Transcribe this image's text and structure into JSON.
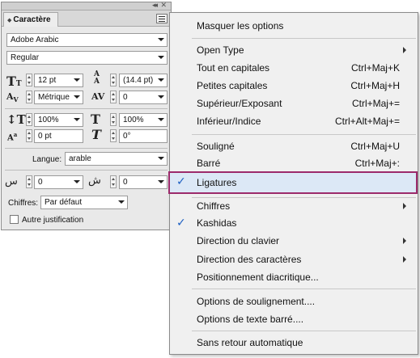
{
  "panel": {
    "tab_label": "Caractère",
    "font_family": "Adobe Arabic",
    "font_style": "Regular",
    "font_size": "12 pt",
    "leading": "(14.4 pt)",
    "kerning": "Métrique",
    "tracking": "0",
    "vertical_scale": "100%",
    "horizontal_scale": "100%",
    "baseline_shift": "0 pt",
    "skew": "0°",
    "language_label": "Langue:",
    "language_value": "arable",
    "insert_spacing_1": "0",
    "insert_spacing_2": "0",
    "digits_label": "Chiffres:",
    "digits_value": "Par défaut",
    "auto_justify_label": "Autre justification",
    "auto_justify_checked": false
  },
  "menu": {
    "items": [
      {
        "label": "Masquer les options",
        "shortcut": "",
        "submenu": false,
        "checked": false
      },
      {
        "label": "Open Type",
        "shortcut": "",
        "submenu": true,
        "checked": false
      },
      {
        "label": "Tout en capitales",
        "shortcut": "Ctrl+Maj+K",
        "submenu": false,
        "checked": false
      },
      {
        "label": "Petites capitales",
        "shortcut": "Ctrl+Maj+H",
        "submenu": false,
        "checked": false
      },
      {
        "label": "Supérieur/Exposant",
        "shortcut": "Ctrl+Maj+=",
        "submenu": false,
        "checked": false
      },
      {
        "label": "Inférieur/Indice",
        "shortcut": "Ctrl+Alt+Maj+=",
        "submenu": false,
        "checked": false
      },
      {
        "label": "Souligné",
        "shortcut": "Ctrl+Maj+U",
        "submenu": false,
        "checked": false
      },
      {
        "label": "Barré",
        "shortcut": "Ctrl+Maj+:",
        "submenu": false,
        "checked": false
      },
      {
        "label": "Ligatures",
        "shortcut": "",
        "submenu": false,
        "checked": true,
        "highlighted": true
      },
      {
        "label": "Chiffres",
        "shortcut": "",
        "submenu": true,
        "checked": false
      },
      {
        "label": "Kashidas",
        "shortcut": "",
        "submenu": false,
        "checked": true
      },
      {
        "label": "Direction du clavier",
        "shortcut": "",
        "submenu": true,
        "checked": false
      },
      {
        "label": "Direction des caractères",
        "shortcut": "",
        "submenu": true,
        "checked": false
      },
      {
        "label": "Positionnement diacritique...",
        "shortcut": "",
        "submenu": false,
        "checked": false
      },
      {
        "label": "Options de soulignement....",
        "shortcut": "",
        "submenu": false,
        "checked": false
      },
      {
        "label": "Options de texte barré....",
        "shortcut": "",
        "submenu": false,
        "checked": false
      },
      {
        "label": "Sans retour automatique",
        "shortcut": "",
        "submenu": false,
        "checked": false
      }
    ],
    "check_glyph": "✓"
  },
  "colors": {
    "highlight_border": "#9c2a6b",
    "highlight_fill": "#dce8f6",
    "check": "#1d5fc2"
  }
}
